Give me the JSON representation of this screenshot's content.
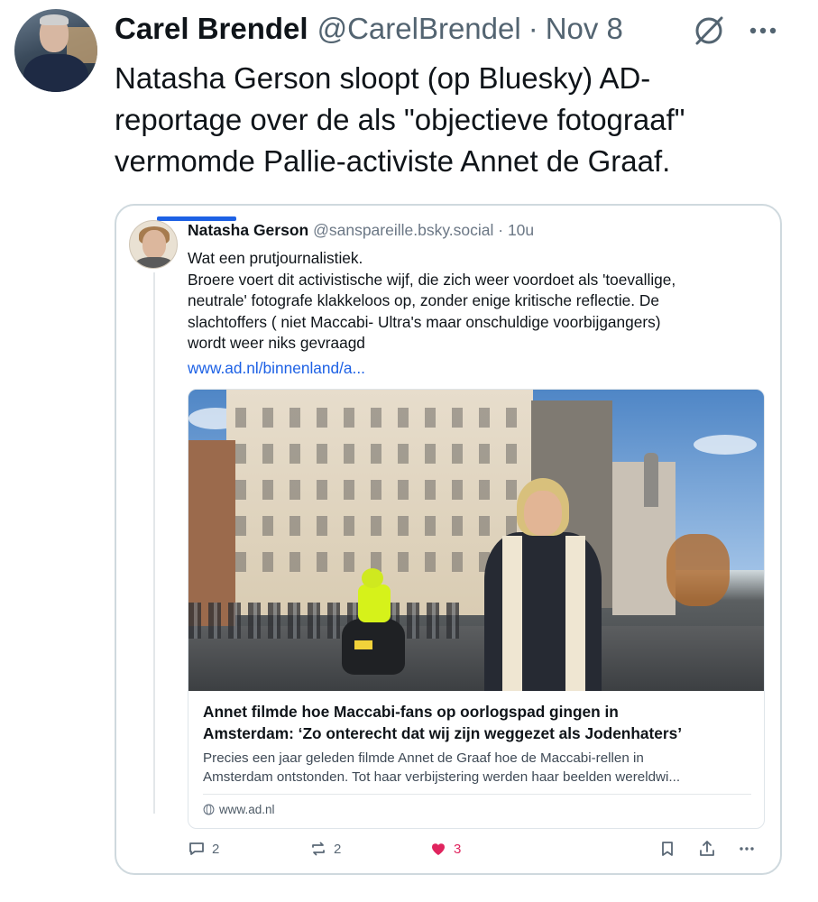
{
  "tweet": {
    "author_name": "Carel Brendel",
    "author_handle": "@CarelBrendel",
    "separator": "·",
    "date": "Nov 8",
    "text": "Natasha Gerson sloopt (op Bluesky) AD-\nreportage over de als \"objectieve fotograaf\"\nvermomde Pallie-activiste Annet de Graaf."
  },
  "embed": {
    "author_name": "Natasha Gerson",
    "author_handle": "@sanspareille.bsky.social · 10u",
    "text": "Wat een prutjournalistiek.\nBroere voert dit activistische wijf, die zich weer voordoet als 'toevallige,\nneutrale' fotografe klakkeloos op, zonder enige kritische reflectie. De\nslachtoffers ( niet Maccabi- Ultra's maar onschuldige voorbijgangers)\nwordt weer niks gevraagd",
    "link_text": "www.ad.nl/binnenland/a...",
    "link_card": {
      "title": "Annet filmde hoe Maccabi-fans op oorlogspad gingen in\nAmsterdam: ‘Zo onterecht dat wij zijn weggezet als Jodenhaters’",
      "description": "Precies een jaar geleden filmde Annet de Graaf hoe de Maccabi-rellen in\nAmsterdam ontstonden. Tot haar verbijstering werden haar beelden wereldwi...",
      "domain": "www.ad.nl"
    },
    "actions": {
      "reply_count": "2",
      "repost_count": "2",
      "like_count": "3"
    }
  },
  "icons": {
    "grok": "grok-icon",
    "more": "more-icon",
    "reply": "reply-icon",
    "repost": "repost-icon",
    "like": "heart-icon",
    "bookmark": "bookmark-icon",
    "share": "share-icon",
    "embed_more": "more-icon",
    "globe": "globe-icon"
  },
  "colors": {
    "link": "#1d61e5",
    "like": "#e0245e",
    "muted": "#536471"
  }
}
